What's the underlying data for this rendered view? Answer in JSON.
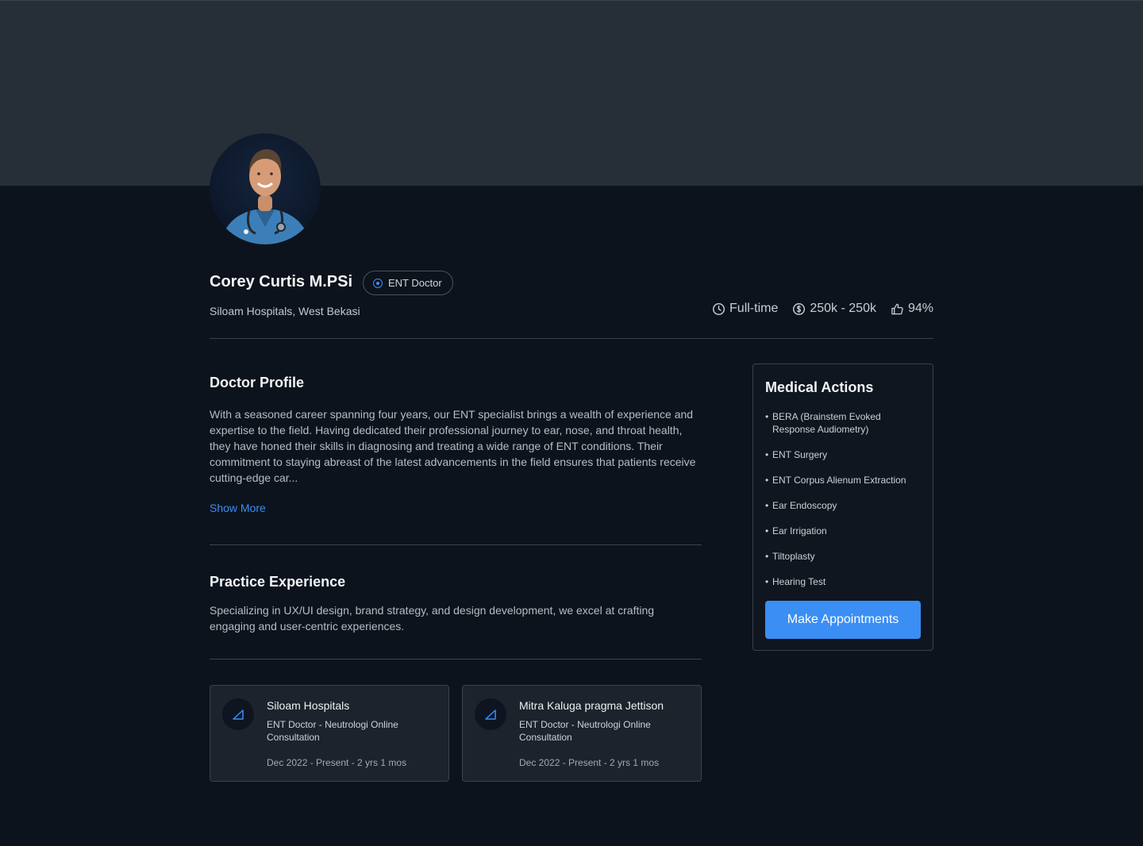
{
  "doctor": {
    "name": "Corey Curtis M.PSi",
    "role_badge": "ENT Doctor",
    "hospital": "Siloam Hospitals, West Bekasi"
  },
  "stats": {
    "employment": "Full-time",
    "fee": "250k - 250k",
    "rating": "94%"
  },
  "profile": {
    "title": "Doctor Profile",
    "text": "With a seasoned career spanning four years, our ENT specialist brings a wealth of experience and expertise to the field. Having dedicated their professional journey to ear, nose, and throat health, they have honed their skills in diagnosing and treating a wide range of ENT conditions. Their commitment to staying abreast of the latest advancements in the field ensures that patients receive cutting-edge car...",
    "show_more": "Show More"
  },
  "practice": {
    "title": "Practice Experience",
    "text": "Specializing in UX/UI design, brand strategy, and design development, we excel at crafting engaging and user-centric experiences.",
    "cards": [
      {
        "title": "Siloam Hospitals",
        "role": "ENT Doctor - Neutrologi Online Consultation",
        "date": "Dec 2022 - Present  - 2 yrs 1 mos"
      },
      {
        "title": "Mitra Kaluga pragma Jettison",
        "role": "ENT Doctor - Neutrologi Online Consultation",
        "date": "Dec 2022 - Present  - 2 yrs 1 mos"
      }
    ]
  },
  "medical_actions": {
    "title": "Medical Actions",
    "items": [
      "BERA (Brainstem Evoked Response Audiometry)",
      "ENT Surgery",
      "ENT Corpus Alienum Extraction",
      "Ear Endoscopy",
      "Ear Irrigation",
      "Tiltoplasty",
      "Hearing Test"
    ],
    "button": "Make Appointments"
  },
  "colors": {
    "accent": "#3b8ef3",
    "background": "#0d131c",
    "cover": "#262e37",
    "card": "#1c232c"
  },
  "icons": {
    "badge": "target-icon",
    "employment": "clock-icon",
    "fee": "dollar-coin-icon",
    "rating": "thumbs-up-icon",
    "experience": "edit-pen-icon"
  }
}
